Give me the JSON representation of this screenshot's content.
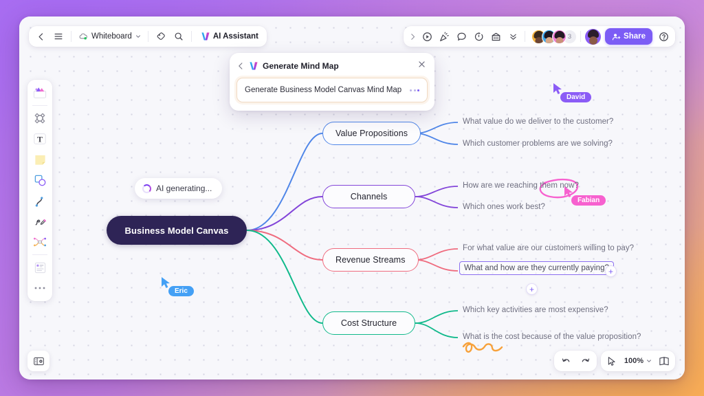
{
  "window": {
    "background_gradient_from": "#a96ef0",
    "background_gradient_to": "#f7ae5c"
  },
  "toolbar_left": {
    "back_icon": "chevron-left-icon",
    "menu_icon": "hamburger-menu-icon",
    "doc_icon": "cloud-check-icon",
    "doc_title": "Whiteboard",
    "doc_chevron": "chevron-down-icon",
    "tag_icon": "tag-icon",
    "search_icon": "search-icon",
    "ai_assistant_label": "AI Assistant",
    "ai_assistant_icon": "ai-sparkle-logo"
  },
  "toolbar_right": {
    "expand_icon": "chevron-right-icon",
    "present_icon": "play-circle-icon",
    "reaction_icon": "celebrate-icon",
    "comment_icon": "comment-bubble-icon",
    "timer_icon": "timer-icon",
    "vote_icon": "vote-box-icon",
    "more_icon": "chevron-double-down-icon",
    "avatar_overflow_count": "3",
    "share_label": "Share",
    "share_icon": "share-person-icon",
    "share_color": "#7c5cf5",
    "help_icon": "question-circle-icon"
  },
  "tool_rail": {
    "items": [
      {
        "name": "ai-tools-icon"
      },
      {
        "name": "frame-icon"
      },
      {
        "name": "text-icon"
      },
      {
        "name": "sticky-note-icon"
      },
      {
        "name": "shapes-icon"
      },
      {
        "name": "connector-line-icon"
      },
      {
        "name": "pen-icon"
      },
      {
        "name": "mindmap-icon"
      },
      {
        "name": "templates-icon"
      },
      {
        "name": "more-tools-icon"
      }
    ]
  },
  "bottom_left": {
    "panel_icon": "comments-panel-icon"
  },
  "ai_dialog": {
    "back_icon": "chevron-left-icon",
    "logo_icon": "ai-sparkle-logo",
    "title": "Generate Mind Map",
    "close_icon": "close-icon",
    "prompt_value": "Generate Business Model Canvas Mind Map",
    "loading_icon": "three-dots-loading"
  },
  "status": {
    "generating_label": "AI generating...",
    "spinner_icon": "loading-spinner-icon"
  },
  "mindmap": {
    "root": {
      "label": "Business Model Canvas",
      "color": "#2e2456"
    },
    "branches": [
      {
        "label": "Value Propositions",
        "color": "#4f86e8",
        "leaves": [
          "What value do we deliver to the customer?",
          "Which customer problems are we solving?"
        ]
      },
      {
        "label": "Channels",
        "color": "#8345d9",
        "leaves": [
          "How are we reaching them now?",
          "Which ones work best?"
        ]
      },
      {
        "label": "Revenue Streams",
        "color": "#ef6b7e",
        "leaves": [
          "For what value are our customers willing to pay?",
          "What and how are they currently paying?"
        ]
      },
      {
        "label": "Cost Structure",
        "color": "#0fb98a",
        "leaves": [
          "Which key activities are most expensive?",
          "What is the cost because of the value proposition?"
        ]
      }
    ],
    "add_child_label": "+",
    "add_sibling_label": "+"
  },
  "collaborators": [
    {
      "name": "David",
      "color": "#8b5cf6"
    },
    {
      "name": "Eric",
      "color": "#44a0f5"
    },
    {
      "name": "Fabian",
      "color": "#f761cf"
    }
  ],
  "annotations": [
    {
      "name": "pink-circle-scribble",
      "color": "#f761cf"
    },
    {
      "name": "orange-squiggle-scribble",
      "color": "#f7a13a"
    }
  ],
  "bottom_bar": {
    "undo_icon": "undo-arrow-icon",
    "redo_icon": "redo-arrow-icon",
    "pointer_icon": "cursor-pointer-icon",
    "zoom_level": "100%",
    "zoom_chevron": "chevron-down-icon",
    "minimap_icon": "minimap-icon"
  }
}
